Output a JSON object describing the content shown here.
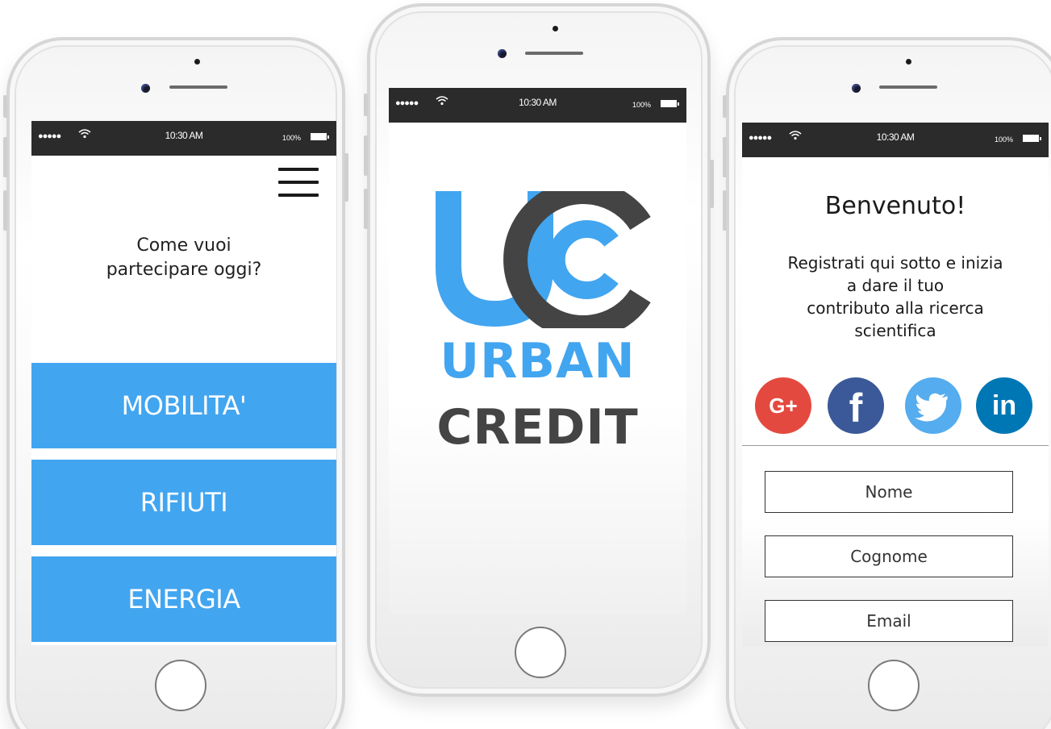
{
  "status_bar": {
    "signal": "●●●●●",
    "wifi": "⌔",
    "time": "10:30 AM",
    "battery": "100%"
  },
  "screen_menu": {
    "question": "Come vuoi partecipare oggi?",
    "question_line1": "Come vuoi",
    "question_line2": "partecipare oggi?",
    "menu_icon": "hamburger-menu-icon",
    "categories": [
      {
        "label": "MOBILITA'"
      },
      {
        "label": "RIFIUTI"
      },
      {
        "label": "ENERGIA"
      }
    ],
    "button_color": "#42a5f0"
  },
  "screen_splash": {
    "brand_line1": "URBAN",
    "brand_line2": "CREDIT",
    "logo_letters": "UC",
    "brand_blue": "#42a5f0",
    "brand_dark": "#444444"
  },
  "screen_signup": {
    "title": "Benvenuto!",
    "intro_lines": [
      "Registrati qui sotto e inizia",
      "a dare il tuo",
      "contributo alla ricerca",
      "scientifica"
    ],
    "social": [
      {
        "name": "google-plus-icon",
        "glyph": "G+",
        "color": "#e4493f"
      },
      {
        "name": "facebook-icon",
        "glyph": "f",
        "color": "#3b5998"
      },
      {
        "name": "twitter-icon",
        "glyph": "bird",
        "color": "#55acee"
      },
      {
        "name": "linkedin-icon",
        "glyph": "in",
        "color": "#0077b5"
      }
    ],
    "fields": {
      "first_name": "Nome",
      "last_name": "Cognome",
      "email": "Email"
    }
  }
}
